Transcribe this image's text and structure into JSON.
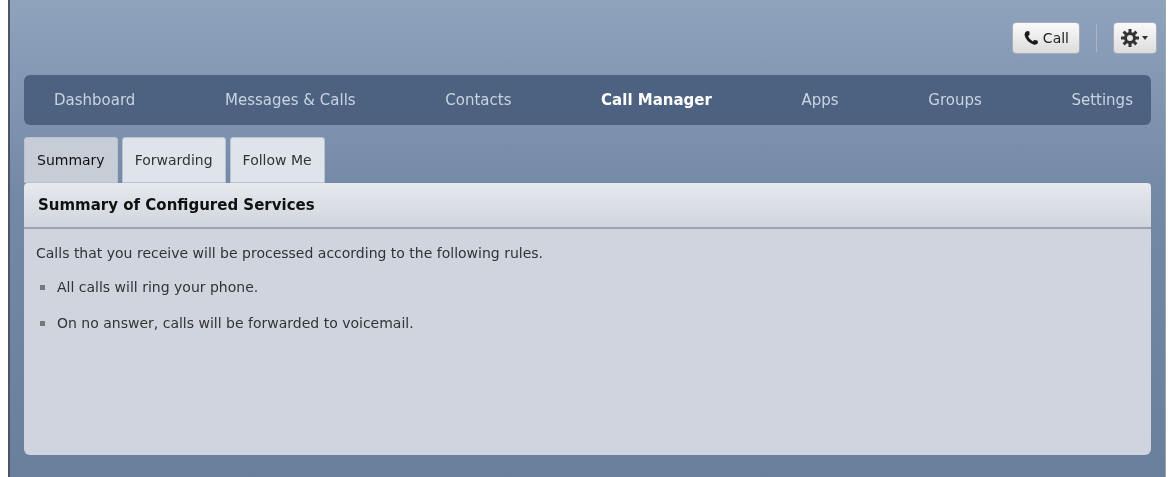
{
  "toolbar": {
    "call_button": "Call"
  },
  "nav": [
    {
      "label": "Dashboard",
      "selected": false
    },
    {
      "label": "Messages & Calls",
      "selected": false
    },
    {
      "label": "Contacts",
      "selected": false
    },
    {
      "label": "Call Manager",
      "selected": true
    },
    {
      "label": "Apps",
      "selected": false
    },
    {
      "label": "Groups",
      "selected": false
    },
    {
      "label": "Settings",
      "selected": false
    }
  ],
  "tabs": [
    {
      "label": "Summary",
      "selected": true
    },
    {
      "label": "Forwarding",
      "selected": false
    },
    {
      "label": "Follow Me",
      "selected": false
    }
  ],
  "panel": {
    "title": "Summary of Configured Services",
    "intro": "Calls that you receive will be processed according to the following rules.",
    "rules": [
      "All calls will ring your phone.",
      "On no answer, calls will be forwarded to voicemail."
    ]
  }
}
